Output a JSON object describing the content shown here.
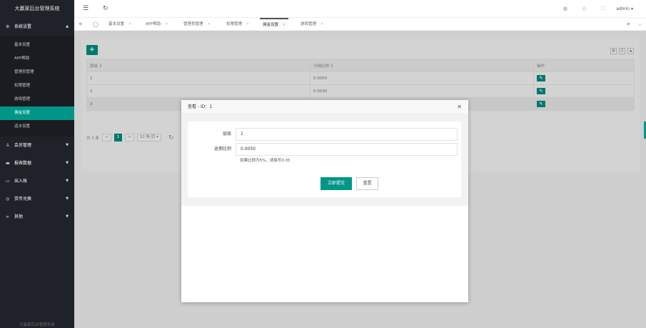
{
  "app": {
    "title": "大赢家后台管理系统"
  },
  "sidebar": {
    "groups": [
      {
        "label": "系统设置",
        "icon": "gear-icon",
        "open": true
      },
      {
        "label": "会员管理",
        "icon": "user-icon"
      },
      {
        "label": "报表数据",
        "icon": "chart-icon"
      },
      {
        "label": "出入账",
        "icon": "wallet-icon"
      },
      {
        "label": "货币兑换",
        "icon": "coin-icon"
      },
      {
        "label": "其他",
        "icon": "link-icon"
      }
    ],
    "sub_items": [
      "基本设置",
      "APP帮助",
      "管理员管理",
      "权限管理",
      "游戏管理",
      "佣金设置",
      "返水设置"
    ],
    "active_sub": "佣金设置"
  },
  "header": {
    "user": "admin ▾",
    "icons": [
      "menu-icon",
      "refresh-icon",
      "theme-icon",
      "tag-icon",
      "fullscreen-icon"
    ]
  },
  "tabs": [
    {
      "label": "基本设置"
    },
    {
      "label": "APP帮助"
    },
    {
      "label": "管理员管理"
    },
    {
      "label": "权限管理"
    },
    {
      "label": "佣金设置",
      "active": true
    },
    {
      "label": "游戏管理"
    }
  ],
  "table": {
    "columns": [
      "层级 ⇕",
      "分佣比例 ⇕",
      "操作"
    ],
    "rows": [
      {
        "level": "1",
        "ratio": "0.0050"
      },
      {
        "level": "2",
        "ratio": "0.0030"
      },
      {
        "level": "3",
        "ratio": ""
      }
    ]
  },
  "pager": {
    "total": "共 3 条",
    "prev": "<",
    "current": "1",
    "next": ">",
    "per_page": "10 条/页 ▾"
  },
  "modal": {
    "title": "查看 - ID：1",
    "close": "✕",
    "fields": [
      {
        "label": "层级",
        "value": "1"
      },
      {
        "label": "返佣比例",
        "value": "0.0050"
      }
    ],
    "hint": "如果比例为5%，请填写0.05",
    "submit": "立即提交",
    "reset": "重置"
  }
}
